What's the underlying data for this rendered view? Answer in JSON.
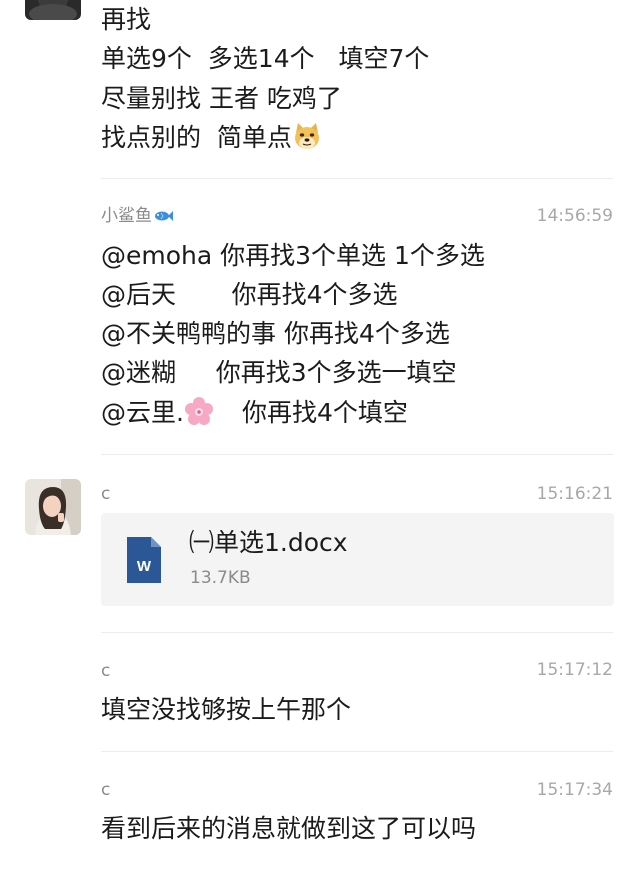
{
  "message_1": {
    "lines": [
      "再找",
      "单选9个  多选14个   填空7个",
      "尽量别找 王者 吃鸡了",
      "找点别的  简单点"
    ],
    "emoji_icon": "doge-emoji-icon"
  },
  "message_2": {
    "sender": "小鲨鱼",
    "sender_emoji_icon": "fish-emoji-icon",
    "time": "14:56:59",
    "lines": [
      "@emoha 你再找3个单选 1个多选",
      "@后天       你再找4个多选",
      "@不关鸭鸭的事 你再找4个多选",
      "@迷糊     你再找3个多选一填空",
      "@云里."
    ],
    "line_5_suffix": "你再找4个填空",
    "line_5_emoji_icon": "cherry-blossom-emoji-icon"
  },
  "message_3": {
    "sender": "c",
    "time": "15:16:21",
    "file": {
      "name": "㈠单选1.docx",
      "size": "13.7KB",
      "icon": "word-document-icon",
      "icon_letter": "W",
      "icon_color": "#2b5797"
    }
  },
  "message_4": {
    "sender": "c",
    "time": "15:17:12",
    "text": "填空没找够按上午那个"
  },
  "message_5": {
    "sender": "c",
    "time": "15:17:34",
    "text": "看到后来的消息就做到这了可以吗"
  }
}
